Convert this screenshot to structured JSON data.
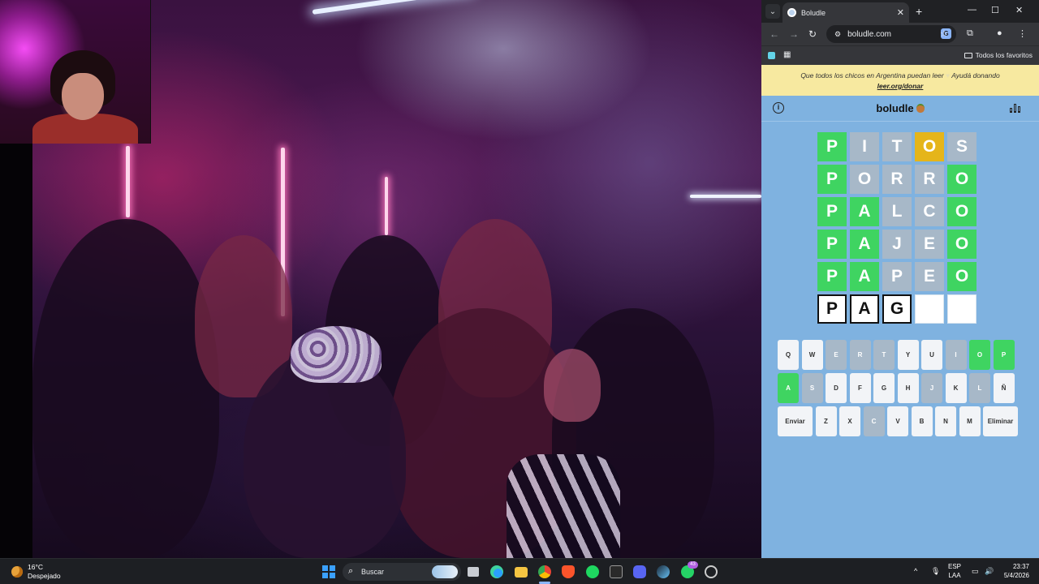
{
  "browser": {
    "tab_title": "Boludle",
    "url": "boludle.com",
    "bookmarks_folder": "Todos los favoritos"
  },
  "banner": {
    "text": "Que todos los chicos en Argentina puedan leer",
    "cta": "Ayudá donando",
    "link": "leer.org/donar"
  },
  "game": {
    "title": "boludle",
    "board": [
      [
        {
          "l": "P",
          "s": "g"
        },
        {
          "l": "I",
          "s": "x"
        },
        {
          "l": "T",
          "s": "x"
        },
        {
          "l": "O",
          "s": "y"
        },
        {
          "l": "S",
          "s": "x"
        }
      ],
      [
        {
          "l": "P",
          "s": "g"
        },
        {
          "l": "O",
          "s": "x"
        },
        {
          "l": "R",
          "s": "x"
        },
        {
          "l": "R",
          "s": "x"
        },
        {
          "l": "O",
          "s": "g"
        }
      ],
      [
        {
          "l": "P",
          "s": "g"
        },
        {
          "l": "A",
          "s": "g"
        },
        {
          "l": "L",
          "s": "x"
        },
        {
          "l": "C",
          "s": "x"
        },
        {
          "l": "O",
          "s": "g"
        }
      ],
      [
        {
          "l": "P",
          "s": "g"
        },
        {
          "l": "A",
          "s": "g"
        },
        {
          "l": "J",
          "s": "x"
        },
        {
          "l": "E",
          "s": "x"
        },
        {
          "l": "O",
          "s": "g"
        }
      ],
      [
        {
          "l": "P",
          "s": "g"
        },
        {
          "l": "A",
          "s": "g"
        },
        {
          "l": "P",
          "s": "x"
        },
        {
          "l": "E",
          "s": "x"
        },
        {
          "l": "O",
          "s": "g"
        }
      ],
      [
        {
          "l": "P",
          "s": "t"
        },
        {
          "l": "A",
          "s": "t"
        },
        {
          "l": "G",
          "s": "t"
        },
        {
          "l": "",
          "s": "e"
        },
        {
          "l": "",
          "s": "e"
        }
      ]
    ],
    "keyboard": [
      [
        {
          "k": "Q",
          "s": ""
        },
        {
          "k": "W",
          "s": ""
        },
        {
          "k": "E",
          "s": "x"
        },
        {
          "k": "R",
          "s": "x"
        },
        {
          "k": "T",
          "s": "x"
        },
        {
          "k": "Y",
          "s": ""
        },
        {
          "k": "U",
          "s": ""
        },
        {
          "k": "I",
          "s": "x"
        },
        {
          "k": "O",
          "s": "g"
        },
        {
          "k": "P",
          "s": "g"
        }
      ],
      [
        {
          "k": "A",
          "s": "g"
        },
        {
          "k": "S",
          "s": "x"
        },
        {
          "k": "D",
          "s": ""
        },
        {
          "k": "F",
          "s": ""
        },
        {
          "k": "G",
          "s": ""
        },
        {
          "k": "H",
          "s": ""
        },
        {
          "k": "J",
          "s": "x"
        },
        {
          "k": "K",
          "s": ""
        },
        {
          "k": "L",
          "s": "x"
        },
        {
          "k": "Ñ",
          "s": ""
        }
      ],
      [
        {
          "k": "Enviar",
          "s": "",
          "w": 1
        },
        {
          "k": "Z",
          "s": ""
        },
        {
          "k": "X",
          "s": ""
        },
        {
          "k": "C",
          "s": "x"
        },
        {
          "k": "V",
          "s": ""
        },
        {
          "k": "B",
          "s": ""
        },
        {
          "k": "N",
          "s": ""
        },
        {
          "k": "M",
          "s": ""
        },
        {
          "k": "Eliminar",
          "s": "",
          "w": 1
        }
      ]
    ]
  },
  "taskbar": {
    "temp": "16°C",
    "weather": "Despejado",
    "search": "Buscar",
    "whatsapp_badge": "43",
    "lang": "ESP",
    "kbd": "LAA",
    "time": "23:37",
    "date": "5/4/2026"
  }
}
